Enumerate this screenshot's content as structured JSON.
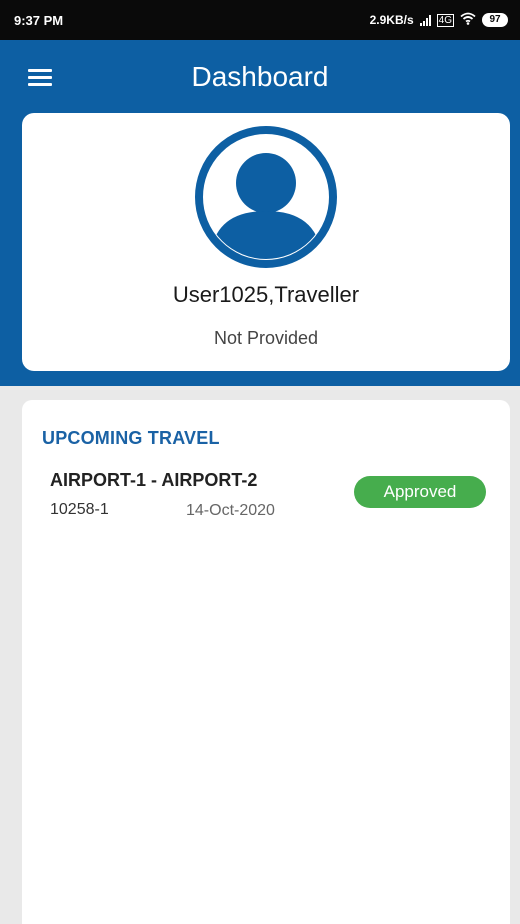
{
  "status_bar": {
    "time": "9:37 PM",
    "network_speed": "2.9KB/s",
    "volte": "VoLTE",
    "wifi_icon": "wifi-icon",
    "battery": "97"
  },
  "header": {
    "title": "Dashboard",
    "menu_icon": "menu-icon",
    "background_color": "#0d5fa3"
  },
  "profile": {
    "avatar_icon": "user-avatar-icon",
    "name": "User1025,Traveller",
    "subtitle": "Not Provided"
  },
  "upcoming_travel": {
    "heading": "UPCOMING TRAVEL",
    "trips": [
      {
        "route": "AIRPORT-1 - AIRPORT-2",
        "id": "10258-1",
        "date": "14-Oct-2020",
        "status": "Approved",
        "status_color": "#46ad4d"
      }
    ]
  }
}
